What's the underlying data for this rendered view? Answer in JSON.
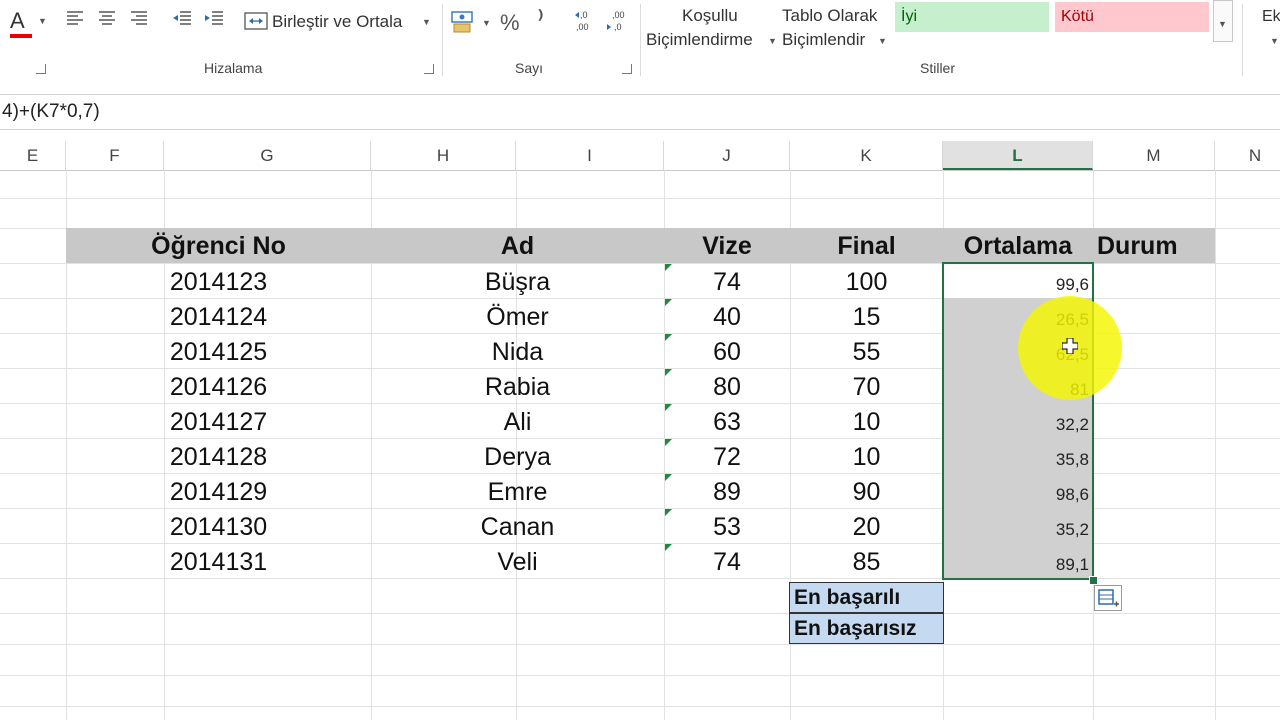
{
  "ribbon": {
    "font_color_letter": "A",
    "merge_label": "Birleştir ve Ortala",
    "percent_symbol": "%",
    "comma_symbol": "⁾",
    "dec_inc_label": "←,0 ,00",
    "dec_dec_label": ",00 →,0",
    "cond_format_line1": "Koşullu",
    "cond_format_line2": "Biçimlendirme",
    "table_format_line1": "Tablo Olarak",
    "table_format_line2": "Biçimlendir",
    "style_good": "İyi",
    "style_bad": "Kötü",
    "ek_label": "Ek",
    "group_alignment": "Hizalama",
    "group_number": "Sayı",
    "group_styles": "Stiller"
  },
  "formula_bar": {
    "text": "4)+(K7*0,7)"
  },
  "columns": [
    "E",
    "F",
    "G",
    "H",
    "I",
    "J",
    "K",
    "L",
    "M",
    "N"
  ],
  "table": {
    "headers": {
      "student_no": "Öğrenci No",
      "name": "Ad",
      "midterm": "Vize",
      "final": "Final",
      "average": "Ortalama",
      "status": "Durum"
    },
    "rows": [
      {
        "no": "2014123",
        "name": "Büşra",
        "vize": "74",
        "final": "100",
        "avg": "99,6"
      },
      {
        "no": "2014124",
        "name": "Ömer",
        "vize": "40",
        "final": "15",
        "avg": "26,5"
      },
      {
        "no": "2014125",
        "name": "Nida",
        "vize": "60",
        "final": "55",
        "avg": "62,5"
      },
      {
        "no": "2014126",
        "name": "Rabia",
        "vize": "80",
        "final": "70",
        "avg": "81"
      },
      {
        "no": "2014127",
        "name": "Ali",
        "vize": "63",
        "final": "10",
        "avg": "32,2"
      },
      {
        "no": "2014128",
        "name": "Derya",
        "vize": "72",
        "final": "10",
        "avg": "35,8"
      },
      {
        "no": "2014129",
        "name": "Emre",
        "vize": "89",
        "final": "90",
        "avg": "98,6"
      },
      {
        "no": "2014130",
        "name": "Canan",
        "vize": "53",
        "final": "20",
        "avg": "35,2"
      },
      {
        "no": "2014131",
        "name": "Veli",
        "vize": "74",
        "final": "85",
        "avg": "89,1"
      }
    ]
  },
  "summary": {
    "best": "En başarılı",
    "worst": "En başarısız"
  },
  "colors": {
    "accent_green": "#217346",
    "style_good_bg": "#c6efce",
    "style_good_fg": "#006100",
    "style_bad_bg": "#ffc7ce",
    "style_bad_fg": "#9c0006",
    "header_gray": "#c8c8c8",
    "label_blue": "#c5d9f1",
    "cursor_highlight": "#f5f500"
  }
}
